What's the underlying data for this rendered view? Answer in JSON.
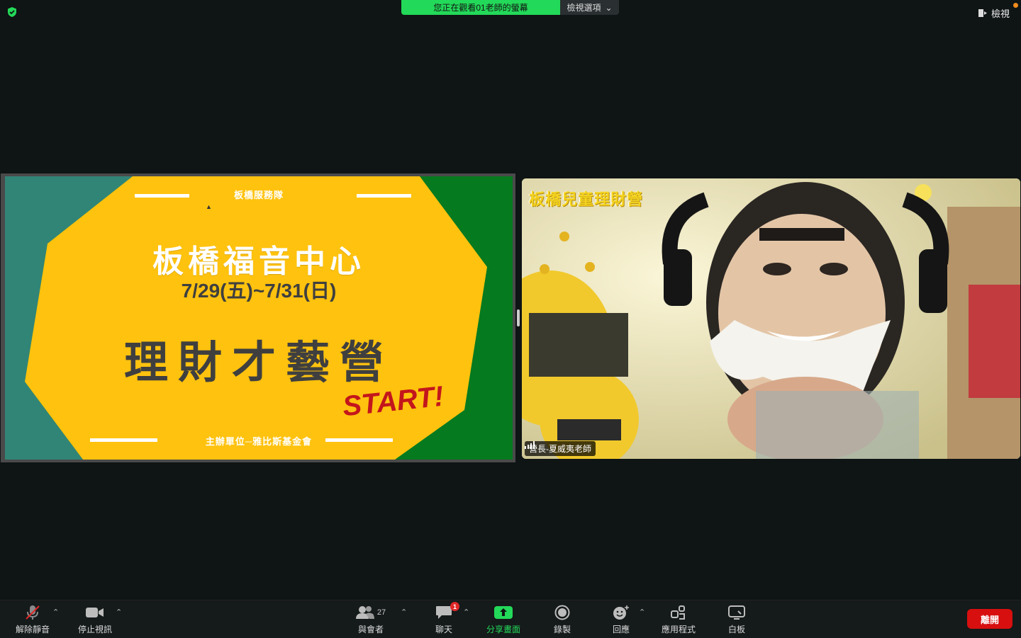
{
  "top": {
    "banner_text": "您正在觀看01老師的螢幕",
    "options_label": "檢視選項",
    "view_label": "檢視"
  },
  "slide": {
    "small_top": "板橋服務隊",
    "main_title": "板橋福音中心",
    "dates": "7/29(五)~7/31(日)",
    "camp_title": "理財才藝營",
    "start": "START!",
    "organizer": "主辦單位─雅比斯基金會"
  },
  "video": {
    "overlay_title": "板橋兒童理財營",
    "name": "營長-夏威夷老師"
  },
  "toolbar": {
    "unmute": "解除靜音",
    "stop_video": "停止視訊",
    "participants": "與會者",
    "participant_count": "27",
    "chat": "聊天",
    "chat_badge": "1",
    "share": "分享畫面",
    "record": "錄製",
    "reactions": "回應",
    "apps": "應用程式",
    "whiteboard": "白板",
    "leave": "離開"
  },
  "colors": {
    "share_green": "#23d959",
    "leave_red": "#d70f0f",
    "slide_yellow": "#ffc20e",
    "slide_green": "#057a1f",
    "slide_teal": "#318577"
  }
}
